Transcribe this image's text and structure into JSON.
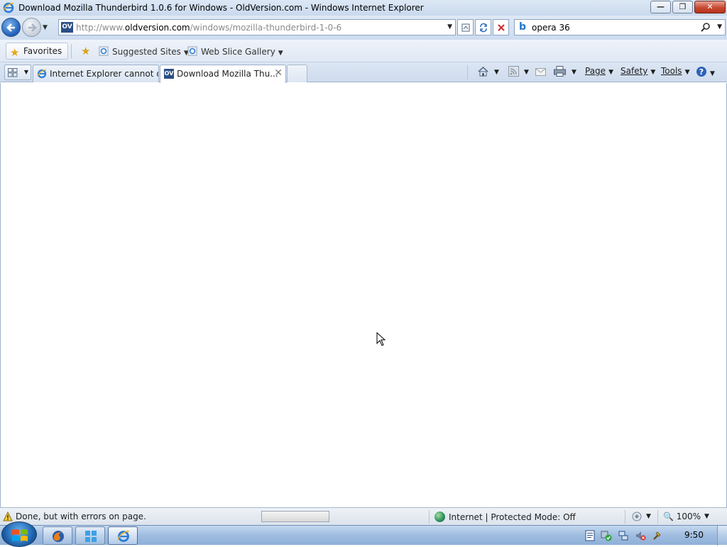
{
  "window": {
    "title": "Download Mozilla Thunderbird 1.0.6 for Windows - OldVersion.com - Windows Internet Explorer",
    "minimize_glyph": "—",
    "maximize_glyph": "❐",
    "close_glyph": "✕"
  },
  "address_bar": {
    "site_badge": "OV",
    "url_prefix": "http://www.",
    "url_host": "oldversion.com",
    "url_path": "/windows/mozilla-thunderbird-1-0-6"
  },
  "search": {
    "provider_glyph": "b",
    "query": "opera 36"
  },
  "favorites_bar": {
    "favorites_label": "Favorites",
    "links": [
      {
        "label": "Suggested Sites"
      },
      {
        "label": "Web Slice Gallery"
      }
    ]
  },
  "tabs": [
    {
      "label": "Internet Explorer cannot di...",
      "icon": "ie-icon",
      "active": false
    },
    {
      "label": "Download Mozilla Thu...",
      "icon": "ov-icon",
      "active": true
    }
  ],
  "command_bar": {
    "page_label": "Page",
    "safety_label": "Safety",
    "tools_label": "Tools"
  },
  "status_bar": {
    "message": "Done, but with errors on page.",
    "zone": "Internet | Protected Mode: Off",
    "zoom": "100%"
  },
  "taskbar": {
    "clock": "9:50"
  },
  "colors": {
    "accent": "#1f5fb7",
    "close_button": "#c74a33"
  }
}
